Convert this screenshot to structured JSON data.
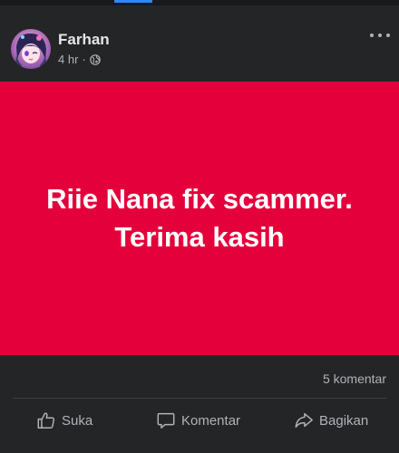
{
  "post": {
    "author": "Farhan",
    "time": "4 hr",
    "separator": "·",
    "privacy_icon": "globe-icon",
    "content_text": "Riie Nana fix scammer. Terima kasih",
    "background_color": "#e4003b",
    "comment_count": "5 komentar"
  },
  "actions": {
    "like_label": "Suka",
    "comment_label": "Komentar",
    "share_label": "Bagikan"
  },
  "icons": {
    "more": "more-options-icon",
    "like": "thumbs-up-icon",
    "comment": "comment-bubble-icon",
    "share": "share-arrow-icon"
  }
}
